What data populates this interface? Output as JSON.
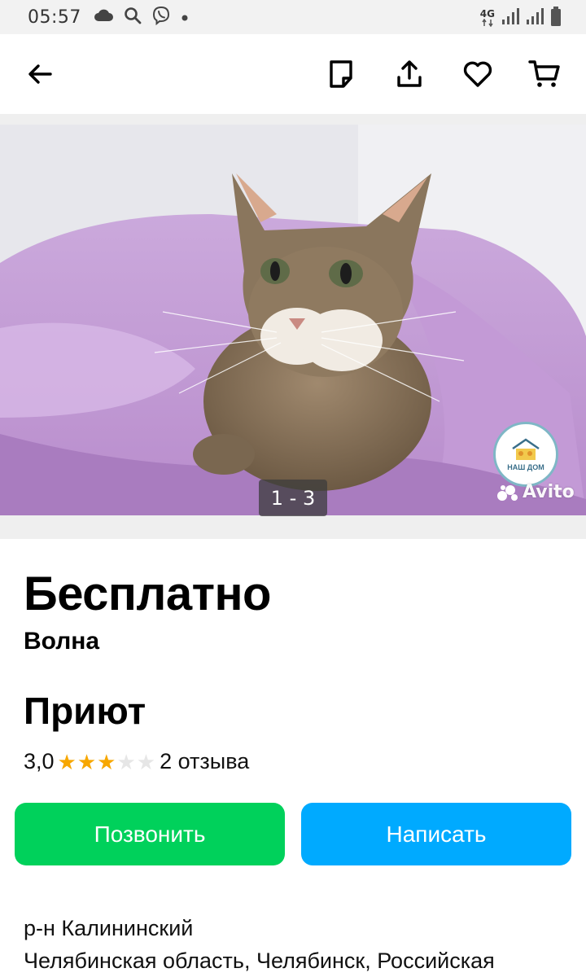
{
  "status_bar": {
    "time": "05:57",
    "network": "4G",
    "icons_left": [
      "cloud-icon",
      "search-icon",
      "viber-icon",
      "dot-icon"
    ],
    "icons_right": [
      "signal-icon",
      "signal-icon",
      "battery-icon"
    ]
  },
  "app_bar": {
    "icons": [
      "back-arrow-icon",
      "note-icon",
      "share-icon",
      "favorite-icon",
      "cart-icon"
    ]
  },
  "gallery": {
    "counter": "1 - 3",
    "watermark": "Avito",
    "logo_text": "НАШ ДОМ"
  },
  "listing": {
    "price": "Бесплатно",
    "title": "Волна"
  },
  "seller": {
    "name": "Приют",
    "rating": "3,0",
    "rating_value": 3,
    "rating_max": 5,
    "reviews": "2 отзыва"
  },
  "actions": {
    "call_label": "Позвонить",
    "write_label": "Написать"
  },
  "location": {
    "district": "р-н Калининский",
    "address": "Челябинская область, Челябинск, Российская"
  },
  "colors": {
    "call_button": "#00d15b",
    "write_button": "#00aaff",
    "star_filled": "#f7a700",
    "star_empty": "#e6e6e6"
  }
}
